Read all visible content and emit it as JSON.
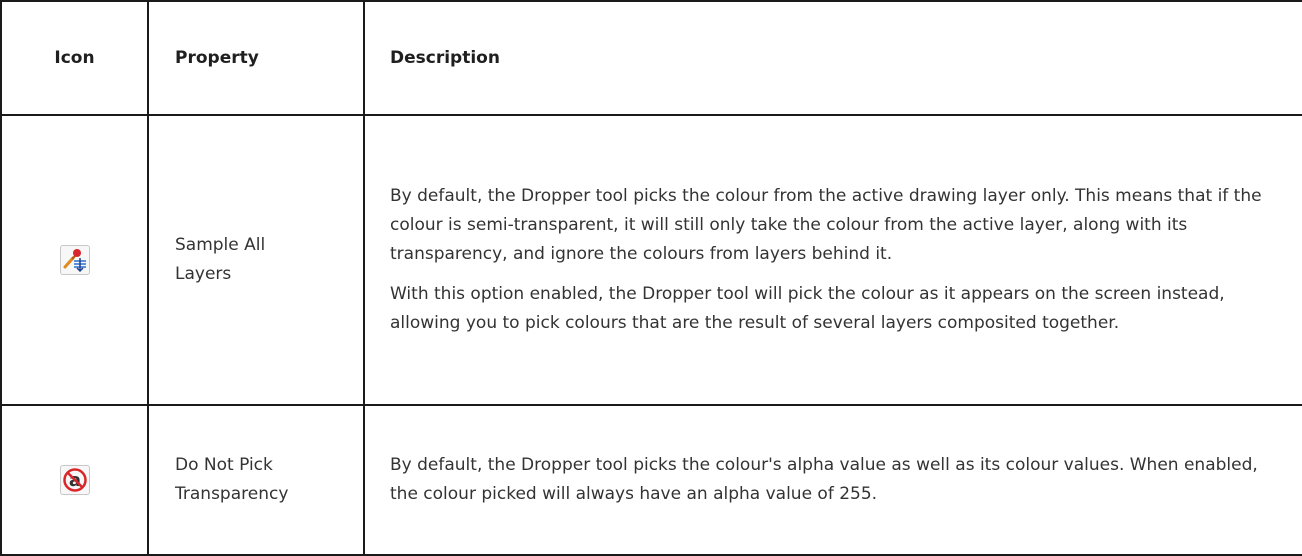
{
  "table": {
    "headers": {
      "icon": "Icon",
      "property": "Property",
      "description": "Description"
    },
    "rows": [
      {
        "icon_name": "dropper-sample-all-layers-icon",
        "property": "Sample All Layers",
        "description": [
          "By default, the Dropper tool picks the colour from the active drawing layer only. This means that if the colour is semi-transparent, it will still only take the colour from the active layer, along with its transparency, and ignore the colours from layers behind it.",
          "With this option enabled, the Dropper tool will pick the colour as it appears on the screen instead, allowing you to pick colours that are the result of several layers composited together."
        ]
      },
      {
        "icon_name": "do-not-pick-transparency-icon",
        "property": "Do Not Pick Transparency",
        "description": [
          "By default, the Dropper tool picks the colour's alpha value as well as its colour values. When enabled, the colour picked will always have an alpha value of 255."
        ]
      }
    ]
  }
}
